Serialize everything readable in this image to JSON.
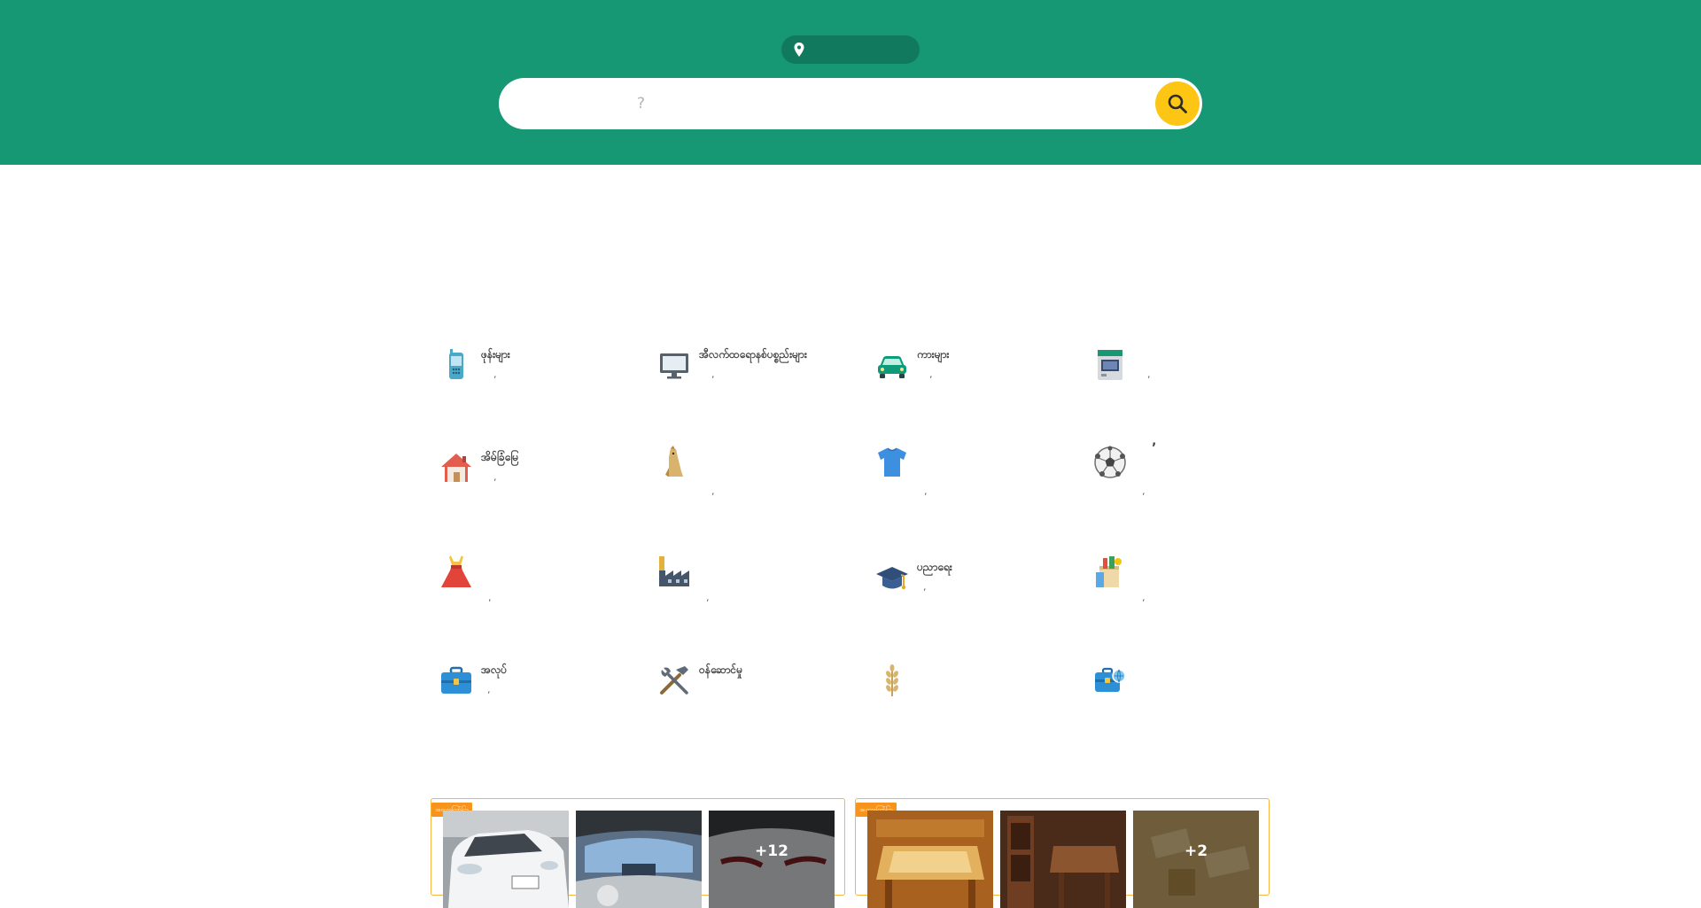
{
  "header": {
    "location_label": "",
    "search_placeholder": "?",
    "search_value": ""
  },
  "categories": [
    {
      "title": "ဖုန်းများ",
      "count": ",",
      "icon": "mobile-phone-icon"
    },
    {
      "title": "အီလက်ထရောနစ်ပစ္စည်းများ",
      "count": ",",
      "icon": "computer-monitor-icon"
    },
    {
      "title": "ကားများ",
      "count": ",",
      "icon": "car-icon"
    },
    {
      "title": "",
      "count": ",",
      "icon": "appliance-icon"
    },
    {
      "title": "အိမ်ခြံမြေ",
      "count": ",",
      "icon": "house-icon"
    },
    {
      "title": "",
      "count": ",",
      "icon": "pet-icon"
    },
    {
      "title": "",
      "count": ",",
      "icon": "tshirt-icon"
    },
    {
      "title": "’",
      "count": ",",
      "icon": "soccer-ball-icon"
    },
    {
      "title": "",
      "count": ",",
      "icon": "dress-icon"
    },
    {
      "title": "",
      "count": ",",
      "icon": "factory-icon"
    },
    {
      "title": "ပညာရေး",
      "count": ",",
      "icon": "graduation-cap-icon"
    },
    {
      "title": "",
      "count": ",",
      "icon": "grocery-bag-icon"
    },
    {
      "title": "အလုပ်",
      "count": ",",
      "icon": "briefcase-icon"
    },
    {
      "title": "ဝန်ဆောင်မှု",
      "count": "",
      "icon": "tools-icon"
    },
    {
      "title": "",
      "count": "",
      "icon": "wheat-icon"
    },
    {
      "title": "",
      "count": "",
      "icon": "overseas-job-icon"
    }
  ],
  "listings": [
    {
      "badge": "အထူးကြော်ငြာ",
      "more": "+12"
    },
    {
      "badge": "အထူးကြော်ငြာ",
      "more": "+2"
    }
  ],
  "colors": {
    "header_bg": "#169875",
    "search_button": "#fdc614",
    "badge": "#f7941d"
  }
}
